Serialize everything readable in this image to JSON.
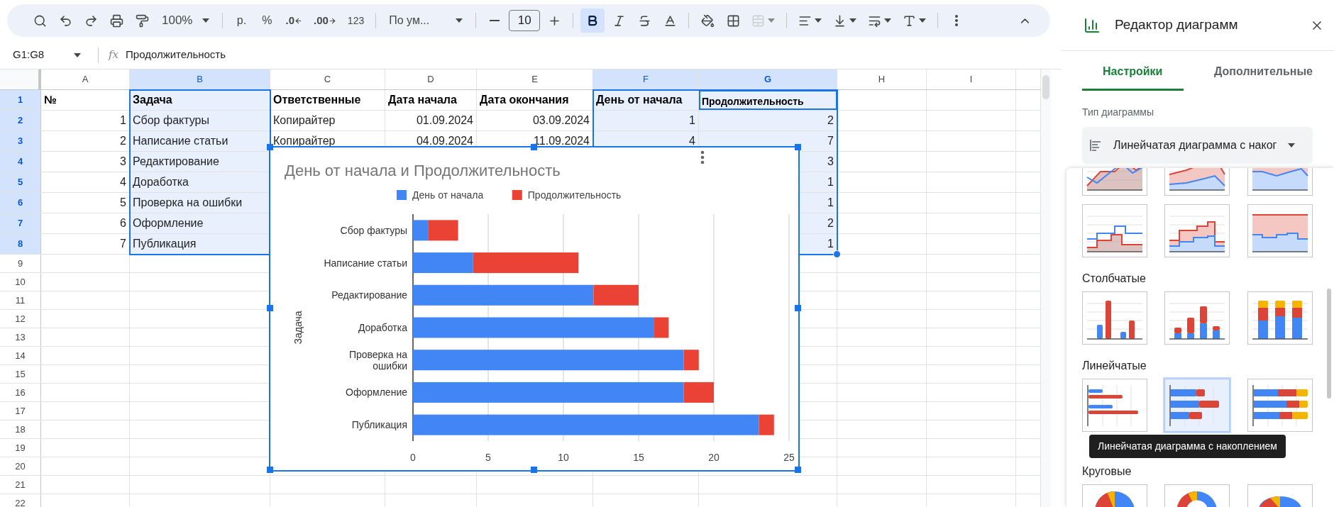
{
  "toolbar": {
    "zoom": "100%",
    "currency": "р.",
    "percent": "%",
    "decrease_decimals": ".0",
    "increase_decimals": ".00",
    "number_format": "123",
    "font": "По ум...",
    "font_size": "10",
    "bold": true,
    "merge_disabled": true
  },
  "formula_bar": {
    "name_box": "G1:G8",
    "function_sign": "fx",
    "formula": "Продолжительность"
  },
  "sheet": {
    "columns": [
      {
        "label": "A",
        "selected": false,
        "active": false,
        "kind": "number"
      },
      {
        "label": "B",
        "selected": true,
        "active": false,
        "kind": "text"
      },
      {
        "label": "C",
        "selected": false,
        "active": false,
        "kind": "text"
      },
      {
        "label": "D",
        "selected": false,
        "active": false,
        "kind": "number"
      },
      {
        "label": "E",
        "selected": false,
        "active": false,
        "kind": "number"
      },
      {
        "label": "F",
        "selected": true,
        "active": false,
        "kind": "number"
      },
      {
        "label": "G",
        "selected": true,
        "active": true,
        "kind": "number"
      },
      {
        "label": "H",
        "selected": false,
        "active": false,
        "kind": "text"
      },
      {
        "label": "I",
        "selected": false,
        "active": false,
        "kind": "text"
      }
    ],
    "rows": [
      {
        "label": "1",
        "selected": true,
        "active": true,
        "kind": "header",
        "cells": [
          "№",
          "Задача",
          "Ответственные",
          "Дата начала",
          "Дата окончания",
          "День от начала",
          "Продолжительность",
          null,
          null
        ]
      },
      {
        "label": "2",
        "selected": true,
        "active": false,
        "kind": "data",
        "cells": [
          "1",
          "Сбор фактуры",
          "Копирайтер",
          "01.09.2024",
          "03.09.2024",
          "1",
          "2",
          null,
          null
        ]
      },
      {
        "label": "3",
        "selected": true,
        "active": false,
        "kind": "data",
        "cells": [
          "2",
          "Написание статьи",
          "Копирайтер",
          "04.09.2024",
          "11.09.2024",
          "4",
          "7",
          null,
          null
        ]
      },
      {
        "label": "4",
        "selected": true,
        "active": false,
        "kind": "data",
        "cells": [
          "3",
          "Редактирование",
          null,
          null,
          null,
          null,
          "3",
          null,
          null
        ]
      },
      {
        "label": "5",
        "selected": true,
        "active": false,
        "kind": "data",
        "cells": [
          "4",
          "Доработка",
          null,
          null,
          null,
          null,
          "1",
          null,
          null
        ]
      },
      {
        "label": "6",
        "selected": true,
        "active": false,
        "kind": "data",
        "cells": [
          "5",
          "Проверка на ошибки",
          null,
          null,
          null,
          null,
          "1",
          null,
          null
        ]
      },
      {
        "label": "7",
        "selected": true,
        "active": false,
        "kind": "data",
        "cells": [
          "6",
          "Оформление",
          null,
          null,
          null,
          null,
          "2",
          null,
          null
        ]
      },
      {
        "label": "8",
        "selected": true,
        "active": false,
        "kind": "data",
        "cells": [
          "7",
          "Публикация",
          null,
          null,
          null,
          null,
          "1",
          null,
          null
        ]
      },
      {
        "label": "9",
        "selected": false,
        "active": false,
        "kind": "data",
        "cells": []
      },
      {
        "label": "10",
        "selected": false,
        "active": false,
        "kind": "data",
        "cells": []
      },
      {
        "label": "11",
        "selected": false,
        "active": false,
        "kind": "data",
        "cells": []
      },
      {
        "label": "12",
        "selected": false,
        "active": false,
        "kind": "data",
        "cells": []
      },
      {
        "label": "13",
        "selected": false,
        "active": false,
        "kind": "data",
        "cells": []
      },
      {
        "label": "14",
        "selected": false,
        "active": false,
        "kind": "data",
        "cells": []
      },
      {
        "label": "15",
        "selected": false,
        "active": false,
        "kind": "data",
        "cells": []
      },
      {
        "label": "16",
        "selected": false,
        "active": false,
        "kind": "data",
        "cells": []
      },
      {
        "label": "17",
        "selected": false,
        "active": false,
        "kind": "data",
        "cells": []
      },
      {
        "label": "18",
        "selected": false,
        "active": false,
        "kind": "data",
        "cells": []
      },
      {
        "label": "19",
        "selected": false,
        "active": false,
        "kind": "data",
        "cells": []
      },
      {
        "label": "20",
        "selected": false,
        "active": false,
        "kind": "data",
        "cells": []
      },
      {
        "label": "21",
        "selected": false,
        "active": false,
        "kind": "data",
        "cells": []
      },
      {
        "label": "22",
        "selected": false,
        "active": false,
        "kind": "data",
        "cells": []
      }
    ]
  },
  "chart": {
    "chart_data": {
      "type": "bar",
      "orientation": "horizontal",
      "stacked": true,
      "title": "День от начала и Продолжительность",
      "ylabel": "Задача",
      "categories": [
        "Сбор фактуры",
        "Написание статьи",
        "Редактирование",
        "Доработка",
        "Проверка на ошибки",
        "Оформление",
        "Публикация"
      ],
      "series": [
        {
          "name": "День от начала",
          "color": "#4285f4",
          "values": [
            1,
            4,
            12,
            16,
            18,
            18,
            23
          ]
        },
        {
          "name": "Продолжительность",
          "color": "#ea4335",
          "values": [
            2,
            7,
            3,
            1,
            1,
            2,
            1
          ]
        }
      ],
      "xlim": [
        0,
        25
      ],
      "xticks": [
        0,
        5,
        10,
        15,
        20,
        25
      ],
      "grid": true,
      "legend": true
    }
  },
  "chart_editor": {
    "title": "Редактор диаграмм",
    "tabs": [
      {
        "label": "Настройки",
        "selected": true
      },
      {
        "label": "Дополнительные",
        "selected": false
      }
    ],
    "chart_type_label": "Тип диаграммы",
    "chart_type_value": "Линейчатая диаграмма с наког",
    "gallery": [
      {
        "thumbnails": [
          {
            "kind": "area",
            "selected": false
          },
          {
            "kind": "stacked-area",
            "selected": false
          },
          {
            "kind": "full-area",
            "selected": false
          },
          {
            "kind": "stepped-area",
            "selected": false
          },
          {
            "kind": "stacked-stepped-area",
            "selected": false
          },
          {
            "kind": "full-stepped-area",
            "selected": false
          }
        ]
      },
      {
        "heading": "Столбчатые",
        "thumbnails": [
          {
            "kind": "column",
            "selected": false
          },
          {
            "kind": "stacked-column",
            "selected": false
          },
          {
            "kind": "full-column",
            "selected": false
          }
        ]
      },
      {
        "heading": "Линейчатые",
        "thumbnails": [
          {
            "kind": "bar",
            "selected": false
          },
          {
            "kind": "stacked-bar",
            "selected": true
          },
          {
            "kind": "full-bar",
            "selected": false
          }
        ]
      },
      {
        "heading": "Круговые",
        "thumbnails": [
          {
            "kind": "pie",
            "selected": false
          },
          {
            "kind": "donut",
            "selected": false
          },
          {
            "kind": "pie-3d",
            "selected": false
          }
        ]
      }
    ],
    "tooltip": "Линейчатая диаграмма с накоплением"
  }
}
